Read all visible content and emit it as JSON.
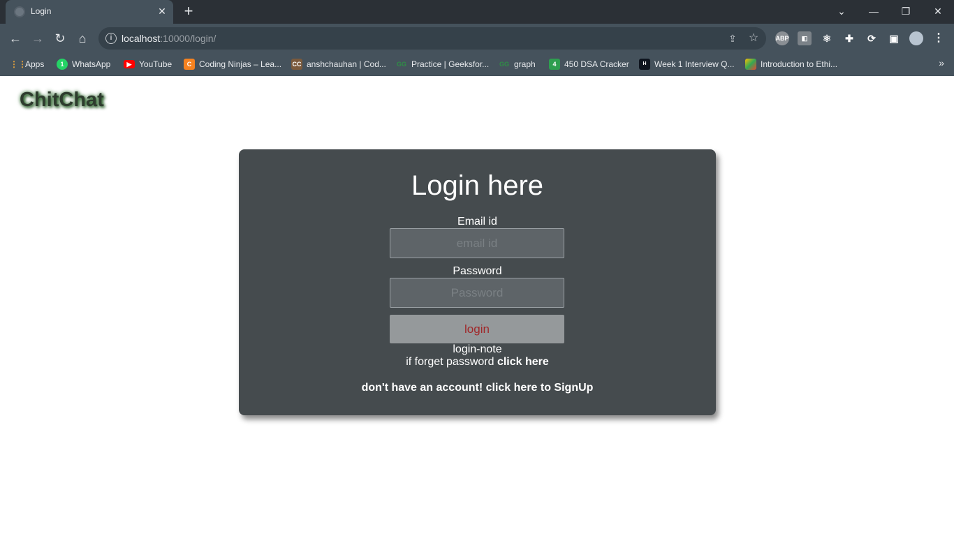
{
  "browser": {
    "tab_title": "Login",
    "url_host": "localhost",
    "url_rest": ":10000/login/",
    "bookmarks": [
      {
        "label": "Apps",
        "icon": "apps-grid-icon"
      },
      {
        "label": "WhatsApp",
        "icon": "whatsapp-icon"
      },
      {
        "label": "YouTube",
        "icon": "youtube-icon"
      },
      {
        "label": "Coding Ninjas – Lea...",
        "icon": "coding-ninjas-icon"
      },
      {
        "label": "anshchauhan | Cod...",
        "icon": "codechef-icon"
      },
      {
        "label": "Practice | Geeksfor...",
        "icon": "geeksforgeeks-icon"
      },
      {
        "label": "graph",
        "icon": "geeksforgeeks-icon"
      },
      {
        "label": "450 DSA Cracker",
        "icon": "dsa-cracker-icon"
      },
      {
        "label": "Week 1 Interview Q...",
        "icon": "hackerrank-icon"
      },
      {
        "label": "Introduction to Ethi...",
        "icon": "google-drive-icon"
      }
    ]
  },
  "app": {
    "logo": "ChitChat"
  },
  "login_form": {
    "heading": "Login here",
    "email_label": "Email id",
    "email_placeholder": "email id",
    "password_label": "Password",
    "password_placeholder": "Password",
    "submit_label": "login",
    "note_label": "login-note",
    "forgot_prefix": "if forget password ",
    "forgot_link": "click here",
    "signup_link": "don't have an account! click here to SignUp"
  },
  "colors": {
    "card_background": "#454b4e",
    "button_text": "#a0282a",
    "logo_glow": "#2f6e2f"
  }
}
